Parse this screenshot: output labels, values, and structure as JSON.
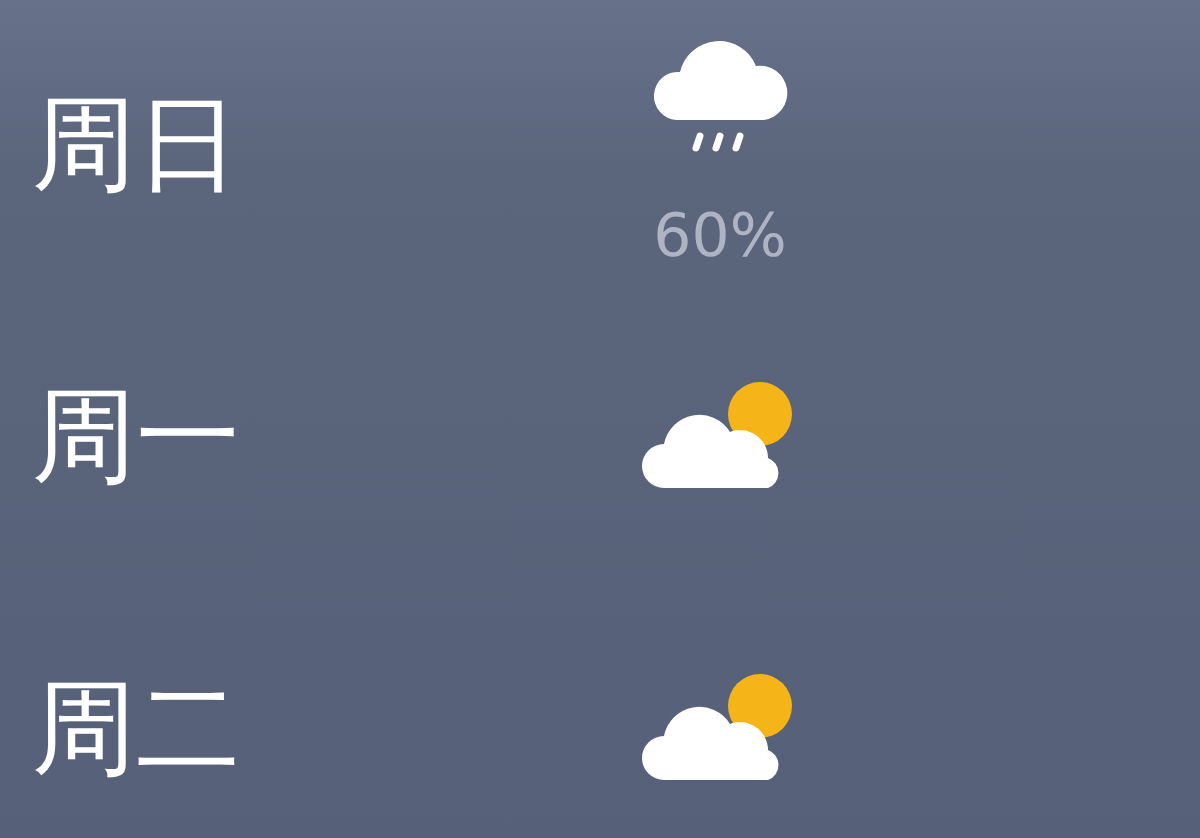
{
  "forecast": [
    {
      "day": "周日",
      "kind": "rain",
      "precipitation": "60%"
    },
    {
      "day": "周一",
      "kind": "partly-cloudy"
    },
    {
      "day": "周二",
      "kind": "partly-cloudy"
    }
  ]
}
